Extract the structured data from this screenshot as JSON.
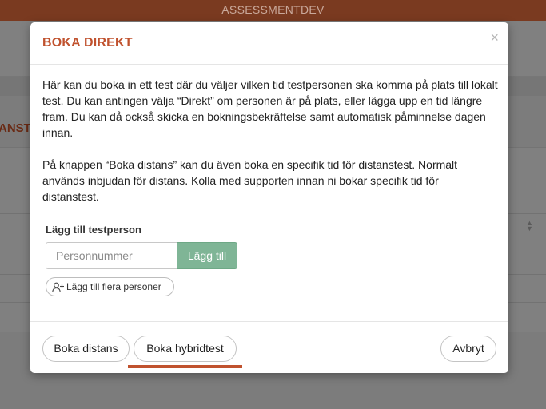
{
  "app": {
    "title": "ASSESSMENTDEV"
  },
  "background": {
    "heading_fragment": "ANSTI"
  },
  "modal": {
    "title": "BOKA DIREKT",
    "close_icon": "×",
    "paragraphs": [
      "Här kan du boka in ett test där du väljer vilken tid testpersonen ska komma på plats till lokalt test. Du kan antingen välja “Direkt” om personen är på plats, eller lägga upp en tid längre fram. Du kan då också skicka en bokningsbekräftelse samt automatisk påminnelse dagen innan.",
      "På knappen “Boka distans” kan du även boka en specifik tid för distanstest. Normalt används inbjudan för distans. Kolla med supporten innan ni bokar specifik tid för distanstest."
    ],
    "add_person": {
      "label": "Lägg till testperson",
      "input_placeholder": "Personnummer",
      "input_value": "",
      "add_button": "Lägg till",
      "multi_button": "Lägg till flera personer",
      "multi_icon": "user-plus-icon"
    },
    "footer": {
      "boka_distans": "Boka distans",
      "boka_hybridtest": "Boka hybridtest",
      "avbryt": "Avbryt"
    }
  },
  "colors": {
    "accent": "#c0522e",
    "topbar": "#7a3a20",
    "add_button": "#7fb596"
  }
}
